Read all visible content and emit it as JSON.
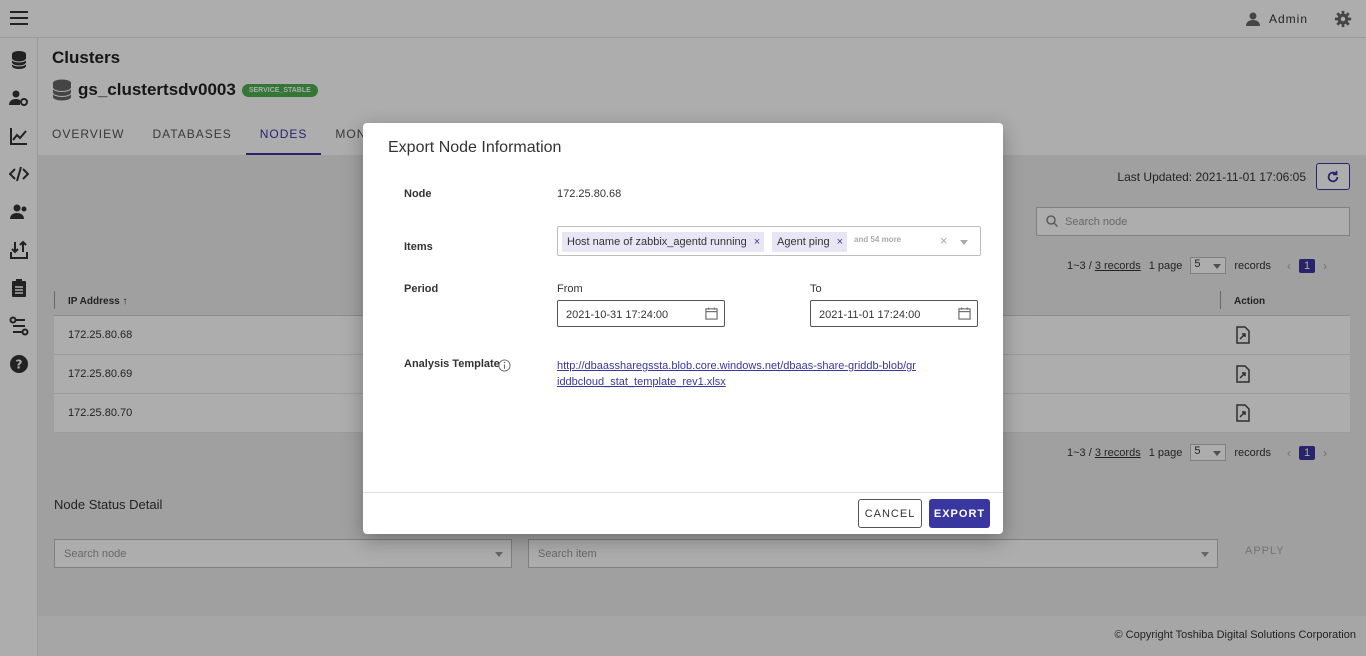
{
  "topbar": {
    "user_name": "Admin"
  },
  "page": {
    "title": "Clusters",
    "cluster_name": "gs_clustertsdv0003",
    "cluster_status": "SERVICE_STABLE",
    "tabs": [
      {
        "label": "OVERVIEW"
      },
      {
        "label": "DATABASES"
      },
      {
        "label": "NODES"
      },
      {
        "label": "MONITOR"
      }
    ],
    "active_tab": "NODES"
  },
  "nodes": {
    "last_updated": "Last Updated: 2021-11-01 17:06:05",
    "search_placeholder": "Search node",
    "pager": {
      "range": "1~3 /",
      "records_link": "3 records",
      "page_text": "1 page",
      "per_page": "5",
      "records_label": "records",
      "current_page": "1"
    },
    "columns": {
      "ip": "IP Address ↑",
      "action": "Action"
    },
    "rows": [
      {
        "ip": "172.25.80.68"
      },
      {
        "ip": "172.25.80.69"
      },
      {
        "ip": "172.25.80.70"
      }
    ]
  },
  "node_status": {
    "title": "Node Status Detail",
    "search_node_placeholder": "Search node",
    "search_item_placeholder": "Search item",
    "apply_label": "APPLY"
  },
  "footer": {
    "copyright": "© Copyright Toshiba Digital Solutions Corporation"
  },
  "dialog": {
    "title": "Export Node Information",
    "node_label": "Node",
    "node_value": "172.25.80.68",
    "items_label": "Items",
    "items": [
      {
        "label": "Host name of zabbix_agentd running"
      },
      {
        "label": "Agent ping"
      }
    ],
    "items_more": "and 54 more",
    "period_label": "Period",
    "from_label": "From",
    "from_value": "2021-10-31 17:24:00",
    "to_label": "To",
    "to_value": "2021-11-01 17:24:00",
    "template_label": "Analysis Template",
    "template_url": "http://dbaassharegssta.blob.core.windows.net/dbaas-share-griddb-blob/griddbcloud_stat_template_rev1.xlsx",
    "cancel_label": "CANCEL",
    "export_label": "EXPORT"
  },
  "colors": {
    "accent": "#3a36a0",
    "status_green": "#4caf50"
  }
}
